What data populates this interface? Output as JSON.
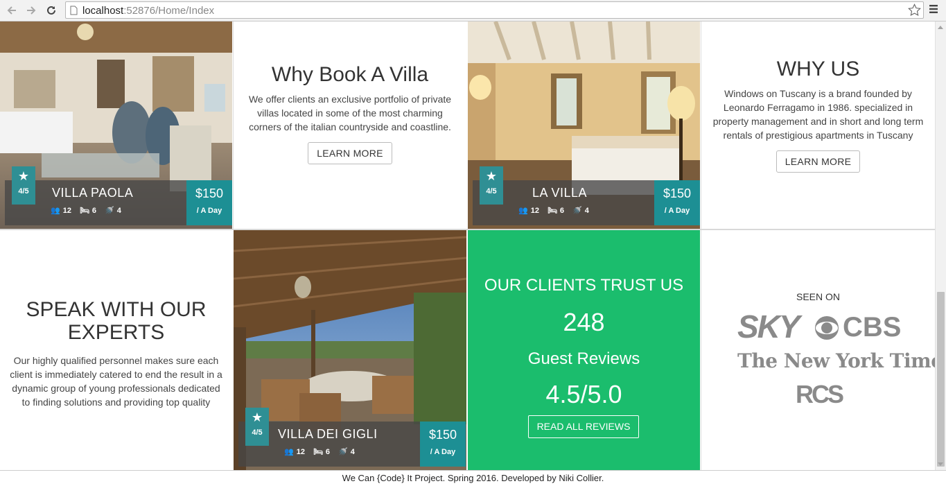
{
  "browser": {
    "url_host": "localhost",
    "url_path": ":52876/Home/Index"
  },
  "villas": [
    {
      "name": "VILLA PAOLA",
      "rating": "4/5",
      "guests": "12",
      "beds": "6",
      "baths": "4",
      "price": "$150",
      "per": "/ A Day"
    },
    {
      "name": "LA VILLA",
      "rating": "4/5",
      "guests": "12",
      "beds": "6",
      "baths": "4",
      "price": "$150",
      "per": "/ A Day"
    },
    {
      "name": "VILLA DEI GIGLI",
      "rating": "4/5",
      "guests": "12",
      "beds": "6",
      "baths": "4",
      "price": "$150",
      "per": "/ A Day"
    }
  ],
  "why_book": {
    "title": "Why Book A Villa",
    "text": "We offer clients an exclusive portfolio of private villas located in some of the most charming corners of the italian countryside and coastline.",
    "button": "LEARN MORE"
  },
  "why_us": {
    "title": "WHY US",
    "text": "Windows on Tuscany is a brand founded by Leonardo Ferragamo in 1986. specialized in property management and in short and long term rentals of prestigious apartments in Tuscany",
    "button": "LEARN MORE"
  },
  "experts": {
    "title": "SPEAK WITH OUR EXPERTS",
    "text": "Our highly qualified personnel makes sure each client is immediately catered to end the result in a dynamic group of young professionals dedicated to finding solutions and providing top quality"
  },
  "trust": {
    "title": "OUR CLIENTS TRUST US",
    "count": "248",
    "count_label": "Guest Reviews",
    "score": "4.5/5.0",
    "button": "READ ALL REVIEWS"
  },
  "seen_on": {
    "label": "SEEN ON",
    "logos": [
      "SKY",
      "CBS",
      "The New York Times",
      "RCS"
    ]
  },
  "footer": {
    "text": "We Can {Code} It Project. Spring 2016. Developed by Niki Collier."
  },
  "colors": {
    "accent_teal": "#1d8f94",
    "trust_green": "#1bbd6d"
  },
  "icons": [
    "back-arrow-icon",
    "forward-arrow-icon",
    "reload-icon",
    "page-icon",
    "bookmark-star-icon",
    "menu-icon",
    "star-icon",
    "guests-icon",
    "bed-icon",
    "shower-icon",
    "cbs-eye-icon"
  ]
}
